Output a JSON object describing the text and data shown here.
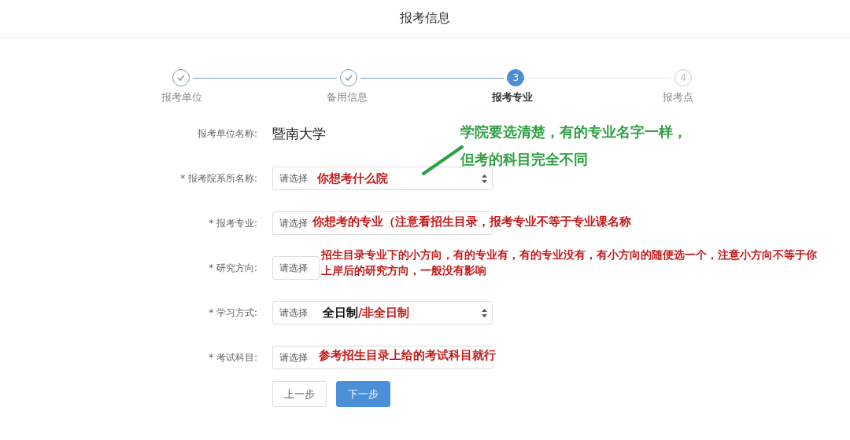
{
  "header": {
    "title": "报考信息"
  },
  "steps": [
    {
      "label": "报考单位",
      "done": true,
      "selected": false
    },
    {
      "label": "备用信息",
      "done": true,
      "selected": false
    },
    {
      "label": "报考专业",
      "done": false,
      "selected": true,
      "number": "3"
    },
    {
      "label": "报考点",
      "done": false,
      "selected": false,
      "number": "4"
    }
  ],
  "form": {
    "fields": [
      {
        "kind": "text",
        "label": "报考单位名称:",
        "value": "暨南大学"
      },
      {
        "kind": "select",
        "label": "* 报考院系所名称:",
        "placeholder": "请选择",
        "note": [
          {
            "kind": "note",
            "text": "你想考什么院"
          }
        ]
      },
      {
        "kind": "select",
        "label": "* 报考专业:",
        "placeholder": "请选择",
        "note": [
          {
            "kind": "note",
            "text": "你想考的专业（注意看招生目录，报考专业不等于专业课名称"
          }
        ]
      },
      {
        "kind": "select",
        "label": "* 研究方向:",
        "placeholder": "请选择",
        "note": [
          {
            "kind": "note",
            "text": "招生目录专业下的小方向，有的专业有，有的专业没有，有小方向的随便选一个，注意小方向不等于你上岸后的研究方向，一般没有影响"
          }
        ]
      },
      {
        "kind": "select",
        "label": "* 学习方式:",
        "placeholder": "请选择",
        "note": [
          {
            "kind": "plain",
            "text": "全日制"
          },
          {
            "kind": "note",
            "text": "/非全日制"
          }
        ]
      },
      {
        "kind": "select",
        "label": "* 考试科目:",
        "placeholder": "请选择",
        "note": [
          {
            "kind": "note",
            "text": "参考招生目录上给的考试科目就行"
          }
        ]
      }
    ],
    "buttons": [
      {
        "label": "上一步",
        "primary": false
      },
      {
        "label": "下一步",
        "primary": true
      }
    ]
  },
  "callout": {
    "lines": [
      "学院要选清楚，有的专业名字一样，",
      "但考的科目完全不同"
    ]
  }
}
